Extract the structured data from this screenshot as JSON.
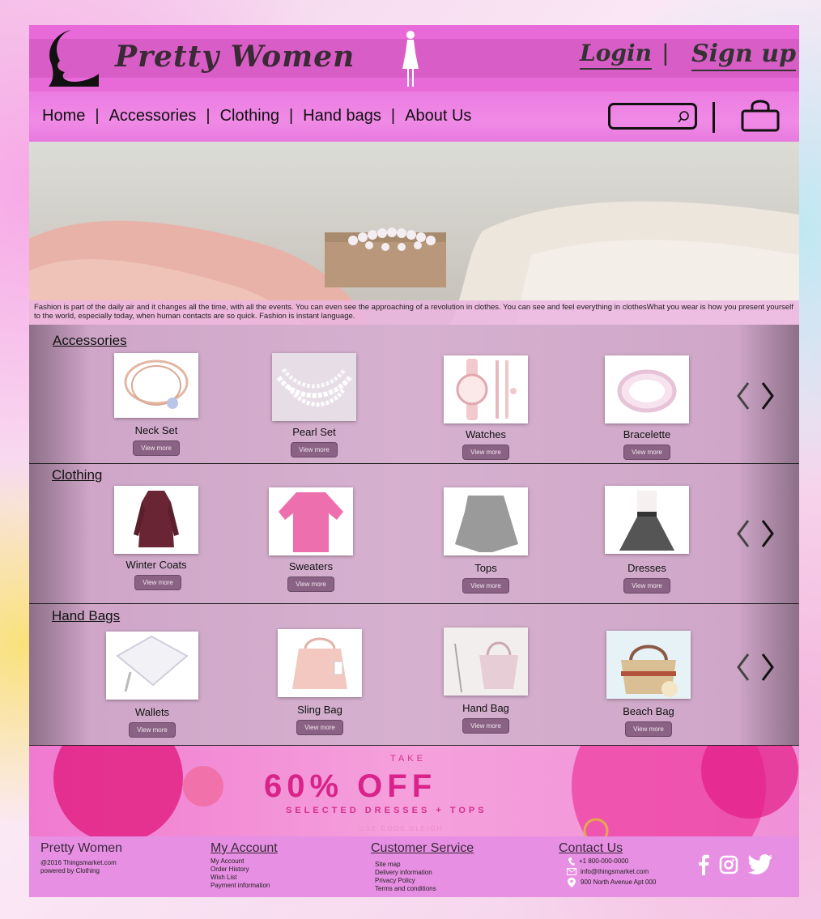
{
  "header": {
    "brand": "Pretty Women",
    "login": "Login",
    "separator": "|",
    "signup": "Sign up"
  },
  "nav": {
    "items": [
      "Home",
      "Accessories",
      "Clothing",
      "Hand bags",
      "About Us"
    ],
    "search_placeholder": "",
    "icons": [
      "search-icon",
      "shopping-bag-icon"
    ]
  },
  "hero": {
    "caption": "Fashion is part of the daily air and it changes all the time, with all the events. You can even see the approaching of a revolution in clothes. You can see and feel everything in clothesWhat you wear is how you present yourself to the world, especially today, when human contacts are so quick. Fashion is instant language."
  },
  "sections": {
    "accessories": {
      "title": "Accessories",
      "products": [
        {
          "name": "Neck Set",
          "button": "View more"
        },
        {
          "name": "Pearl Set",
          "button": "View more"
        },
        {
          "name": "Watches",
          "button": "View more"
        },
        {
          "name": "Bracelette",
          "button": "View more"
        }
      ]
    },
    "clothing": {
      "title": "Clothing",
      "products": [
        {
          "name": "Winter Coats",
          "button": "View more"
        },
        {
          "name": "Sweaters",
          "button": "View more"
        },
        {
          "name": "Tops",
          "button": "View more"
        },
        {
          "name": "Dresses",
          "button": "View more"
        }
      ]
    },
    "handbags": {
      "title": "Hand Bags",
      "products": [
        {
          "name": "Wallets",
          "button": "View more"
        },
        {
          "name": "Sling Bag",
          "button": "View more"
        },
        {
          "name": "Hand Bag",
          "button": "View more"
        },
        {
          "name": "Beach Bag",
          "button": "View more"
        }
      ]
    }
  },
  "promo": {
    "take": "TAKE",
    "headline": "60% OFF",
    "subline": "SELECTED DRESSES + TOPS",
    "code": "USE CODE SLEIGH"
  },
  "footer": {
    "brand": {
      "title": "Pretty Women",
      "lines": [
        "@2016 Thingsmarket.com",
        "powered by Clothing"
      ]
    },
    "account": {
      "title": "My Account",
      "lines": [
        "My Account",
        "Order History",
        "Wish List",
        "Payment information"
      ]
    },
    "service": {
      "title": "Customer Service",
      "lines": [
        "Site map",
        "Delivery information",
        "Privacy Policy",
        "Terms and conditions"
      ]
    },
    "contact": {
      "title": "Contact Us",
      "phone": "+1 800-000-0000",
      "email": "info@thingsmarket.com",
      "address": "900 North Avenue Apt 000"
    },
    "social": [
      "facebook-icon",
      "instagram-icon",
      "twitter-icon"
    ]
  },
  "colors": {
    "header": "#d95dc6",
    "nav": "#f08ae6",
    "footer": "#e78fe3",
    "button": "#8a6283",
    "promo": "#d9228a"
  }
}
